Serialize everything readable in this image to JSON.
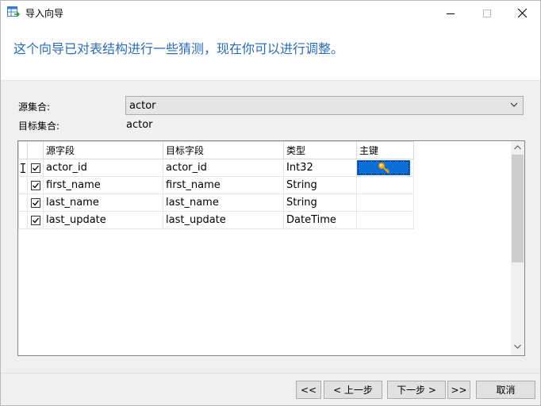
{
  "window": {
    "title": "导入向导"
  },
  "heading": "这个向导已对表结构进行一些猜测，现在你可以进行调整。",
  "form": {
    "source_label": "源集合:",
    "source_value": "actor",
    "target_label": "目标集合:",
    "target_value": "actor"
  },
  "grid": {
    "headers": {
      "source": "源字段",
      "target": "目标字段",
      "type": "类型",
      "key": "主键"
    },
    "rows": [
      {
        "source": "actor_id",
        "target": "actor_id",
        "type": "Int32",
        "checked": true,
        "primary_key": true,
        "current": true
      },
      {
        "source": "first_name",
        "target": "first_name",
        "type": "String",
        "checked": true,
        "primary_key": false,
        "current": false
      },
      {
        "source": "last_name",
        "target": "last_name",
        "type": "String",
        "checked": true,
        "primary_key": false,
        "current": false
      },
      {
        "source": "last_update",
        "target": "last_update",
        "type": "DateTime",
        "checked": true,
        "primary_key": false,
        "current": false
      }
    ]
  },
  "buttons": {
    "first": "<<",
    "prev": "< 上一步",
    "next": "下一步 >",
    "last": ">>",
    "cancel": "取消"
  },
  "colors": {
    "heading": "#2b6cb3",
    "selection": "#0a6fd8",
    "key_icon": "#e8a317"
  }
}
